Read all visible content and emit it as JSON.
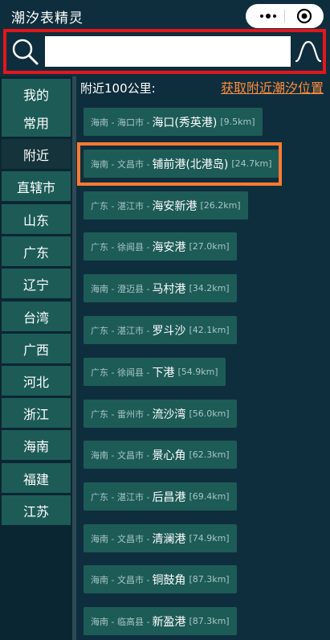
{
  "header": {
    "title": "潮汐表精灵"
  },
  "search": {
    "value": "",
    "placeholder": ""
  },
  "sidebar": {
    "items": [
      {
        "label": "我的"
      },
      {
        "label": "常用"
      },
      {
        "label": "附近"
      },
      {
        "label": "直辖市"
      },
      {
        "label": "山东"
      },
      {
        "label": "广东"
      },
      {
        "label": "辽宁"
      },
      {
        "label": "台湾"
      },
      {
        "label": "广西"
      },
      {
        "label": "河北"
      },
      {
        "label": "浙江"
      },
      {
        "label": "海南"
      },
      {
        "label": "福建"
      },
      {
        "label": "江苏"
      }
    ],
    "active_index": 2
  },
  "content": {
    "title": "附近100公里:",
    "locate_link": "获取附近潮汐位置",
    "ports": [
      {
        "region": "海南 - 海口市 - ",
        "name": "海口(秀英港)",
        "dist": "[9.5km]"
      },
      {
        "region": "海南 - 文昌市 - ",
        "name": "铺前港(北港岛)",
        "dist": "[24.7km]"
      },
      {
        "region": "广东 - 湛江市 - ",
        "name": "海安新港",
        "dist": "[26.2km]"
      },
      {
        "region": "广东 - 徐闻县 - ",
        "name": "海安港",
        "dist": "[27.0km]"
      },
      {
        "region": "海南 - 澄迈县 - ",
        "name": "马村港",
        "dist": "[34.2km]"
      },
      {
        "region": "广东 - 湛江市 - ",
        "name": "罗斗沙",
        "dist": "[42.1km]"
      },
      {
        "region": "广东 - 徐闻县 - ",
        "name": "下港",
        "dist": "[54.9km]"
      },
      {
        "region": "广东 - 雷州市 - ",
        "name": "流沙湾",
        "dist": "[56.0km]"
      },
      {
        "region": "海南 - 文昌市 - ",
        "name": "景心角",
        "dist": "[62.3km]"
      },
      {
        "region": "广东 - 湛江市 - ",
        "name": "后昌港",
        "dist": "[69.4km]"
      },
      {
        "region": "海南 - 文昌市 - ",
        "name": "清澜港",
        "dist": "[74.9km]"
      },
      {
        "region": "海南 - 文昌市 - ",
        "name": "铜鼓角",
        "dist": "[87.3km]"
      },
      {
        "region": "海南 - 临高县 - ",
        "name": "新盈港",
        "dist": "[87.3km]"
      }
    ]
  },
  "colors": {
    "background": "#0f2e3d",
    "item": "#1d5b57",
    "accent": "#ff8c3a",
    "search_outline": "#e4161c"
  },
  "icons": [
    "search-icon",
    "wave-icon",
    "more-icon",
    "close-circle-icon"
  ]
}
